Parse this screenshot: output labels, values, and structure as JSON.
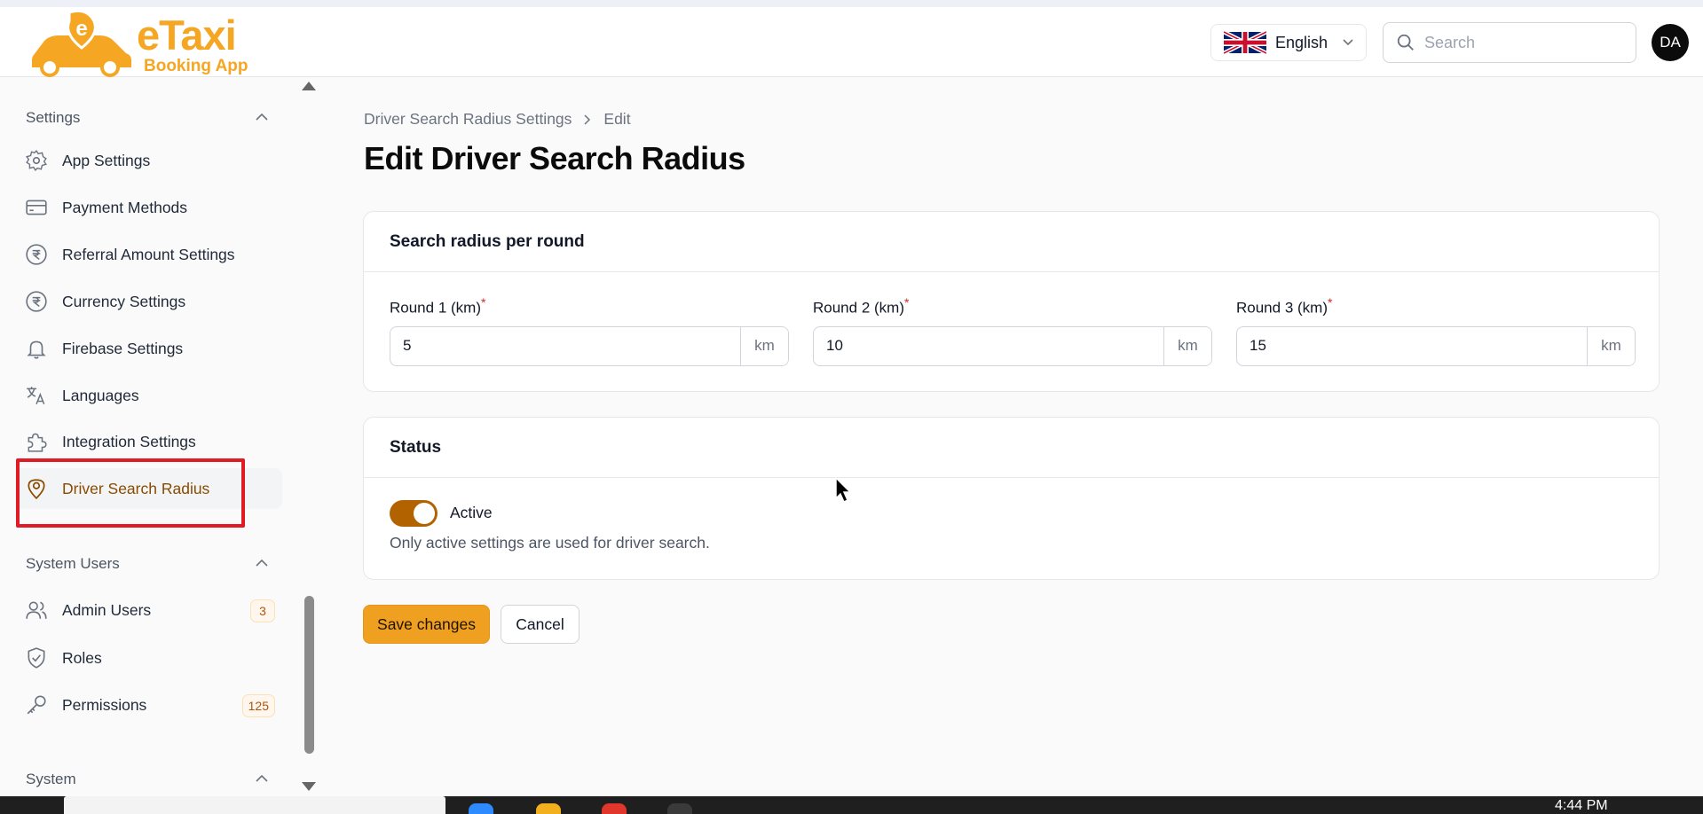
{
  "app": {
    "logo_title": "eTaxi",
    "logo_subtitle": "Booking App",
    "brand_color": "#f5a623"
  },
  "header": {
    "language": "English",
    "search_placeholder": "Search",
    "avatar_initials": "DA"
  },
  "sidebar": {
    "groups": [
      {
        "title": "Settings",
        "items": [
          {
            "label": "App Settings",
            "icon": "gear-icon"
          },
          {
            "label": "Payment Methods",
            "icon": "credit-card-icon"
          },
          {
            "label": "Referral Amount Settings",
            "icon": "rupee-icon"
          },
          {
            "label": "Currency Settings",
            "icon": "rupee-icon"
          },
          {
            "label": "Firebase Settings",
            "icon": "bell-icon"
          },
          {
            "label": "Languages",
            "icon": "translate-icon"
          },
          {
            "label": "Integration Settings",
            "icon": "puzzle-icon"
          },
          {
            "label": "Driver Search Radius",
            "icon": "map-pin-icon",
            "active": true
          }
        ]
      },
      {
        "title": "System Users",
        "items": [
          {
            "label": "Admin Users",
            "icon": "users-icon",
            "badge": "3"
          },
          {
            "label": "Roles",
            "icon": "shield-check-icon"
          },
          {
            "label": "Permissions",
            "icon": "key-icon",
            "badge": "125"
          }
        ]
      },
      {
        "title": "System",
        "items": []
      }
    ]
  },
  "breadcrumb": {
    "parent": "Driver Search Radius Settings",
    "current": "Edit"
  },
  "page": {
    "title": "Edit Driver Search Radius"
  },
  "radius_card": {
    "title": "Search radius per round",
    "unit": "km",
    "fields": [
      {
        "label": "Round 1 (km)",
        "value": "5"
      },
      {
        "label": "Round 2 (km)",
        "value": "10"
      },
      {
        "label": "Round 3 (km)",
        "value": "15"
      }
    ]
  },
  "status_card": {
    "title": "Status",
    "toggle_label": "Active",
    "toggle_on": true,
    "help_text": "Only active settings are used for driver search."
  },
  "actions": {
    "save_label": "Save changes",
    "cancel_label": "Cancel"
  },
  "taskbar": {
    "time": "4:44 PM"
  },
  "colors": {
    "accent": "#f0a020",
    "toggle": "#b36200",
    "active_text": "#8a4b00",
    "highlight_box": "#e01b24"
  }
}
